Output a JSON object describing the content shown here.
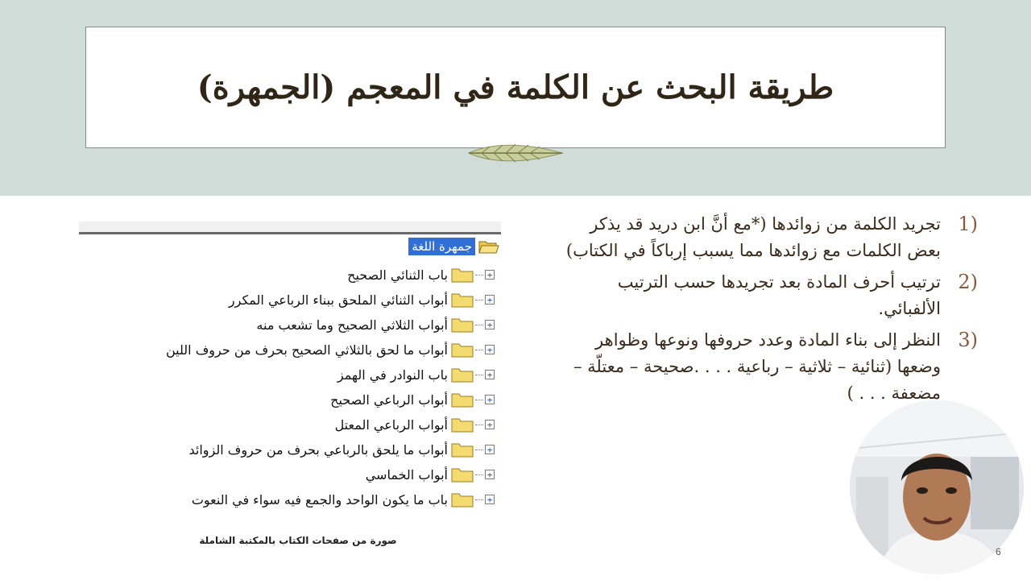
{
  "slide": {
    "title": "طريقة البحث عن الكلمة في المعجم (الجمهرة)",
    "page_number": "6",
    "colors": {
      "top_band": "#d0dcd8",
      "title_text": "#2f2618",
      "number_color": "#8a5a3c"
    }
  },
  "list": {
    "items": [
      {
        "num": "1)",
        "text": "تجريد الكلمة من زوائدها (*مع أنَّ ابن دريد قد يذكر بعض الكلمات مع زوائدها مما يسبب إرباكاً في الكتاب)"
      },
      {
        "num": "2)",
        "text": "ترتيب أحرف المادة بعد تجريدها حسب الترتيب الألفبائي."
      },
      {
        "num": "3)",
        "text": "النظر إلى بناء المادة وعدد حروفها ونوعها وظواهر وضعها (ثنائية – ثلاثية – رباعية . . . .صحيحة – معتلّة – مضعفة . . . )"
      }
    ]
  },
  "tree": {
    "root_label": "جمهرة اللغة",
    "items": [
      "باب الثنائي الصحيح",
      "أبواب الثنائي الملحق ببناء الرباعي المكرر",
      "أبواب الثلاثي الصحيح وما تشعب منه",
      "أبواب ما لحق بالثلاثي الصحيح بحرف من حروف اللين",
      "باب النوادر في الهمز",
      "أبواب الرباعي الصحيح",
      "أبواب الرباعي المعتل",
      "أبواب ما يلحق بالرباعي بحرف من حروف الزوائد",
      "أبواب الخماسي",
      "باب ما يكون الواحد والجمع فيه سواء في النعوت"
    ],
    "caption": "صورة من صفحات الكتاب بالمكتبة الشاملة",
    "icons": {
      "root": "open-folder-icon",
      "item": "folder-icon",
      "expander": "plus-box-icon"
    }
  },
  "webcam": {
    "icon": "presenter-video-icon"
  }
}
